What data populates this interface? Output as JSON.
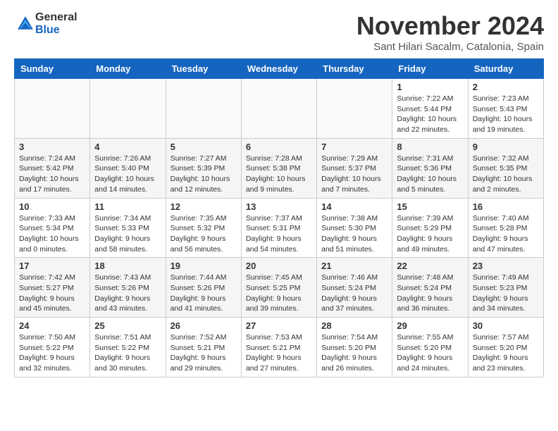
{
  "header": {
    "logo_general": "General",
    "logo_blue": "Blue",
    "month_title": "November 2024",
    "location": "Sant Hilari Sacalm, Catalonia, Spain"
  },
  "days_of_week": [
    "Sunday",
    "Monday",
    "Tuesday",
    "Wednesday",
    "Thursday",
    "Friday",
    "Saturday"
  ],
  "weeks": [
    [
      {
        "day": "",
        "info": ""
      },
      {
        "day": "",
        "info": ""
      },
      {
        "day": "",
        "info": ""
      },
      {
        "day": "",
        "info": ""
      },
      {
        "day": "",
        "info": ""
      },
      {
        "day": "1",
        "info": "Sunrise: 7:22 AM\nSunset: 5:44 PM\nDaylight: 10 hours and 22 minutes."
      },
      {
        "day": "2",
        "info": "Sunrise: 7:23 AM\nSunset: 5:43 PM\nDaylight: 10 hours and 19 minutes."
      }
    ],
    [
      {
        "day": "3",
        "info": "Sunrise: 7:24 AM\nSunset: 5:42 PM\nDaylight: 10 hours and 17 minutes."
      },
      {
        "day": "4",
        "info": "Sunrise: 7:26 AM\nSunset: 5:40 PM\nDaylight: 10 hours and 14 minutes."
      },
      {
        "day": "5",
        "info": "Sunrise: 7:27 AM\nSunset: 5:39 PM\nDaylight: 10 hours and 12 minutes."
      },
      {
        "day": "6",
        "info": "Sunrise: 7:28 AM\nSunset: 5:38 PM\nDaylight: 10 hours and 9 minutes."
      },
      {
        "day": "7",
        "info": "Sunrise: 7:29 AM\nSunset: 5:37 PM\nDaylight: 10 hours and 7 minutes."
      },
      {
        "day": "8",
        "info": "Sunrise: 7:31 AM\nSunset: 5:36 PM\nDaylight: 10 hours and 5 minutes."
      },
      {
        "day": "9",
        "info": "Sunrise: 7:32 AM\nSunset: 5:35 PM\nDaylight: 10 hours and 2 minutes."
      }
    ],
    [
      {
        "day": "10",
        "info": "Sunrise: 7:33 AM\nSunset: 5:34 PM\nDaylight: 10 hours and 0 minutes."
      },
      {
        "day": "11",
        "info": "Sunrise: 7:34 AM\nSunset: 5:33 PM\nDaylight: 9 hours and 58 minutes."
      },
      {
        "day": "12",
        "info": "Sunrise: 7:35 AM\nSunset: 5:32 PM\nDaylight: 9 hours and 56 minutes."
      },
      {
        "day": "13",
        "info": "Sunrise: 7:37 AM\nSunset: 5:31 PM\nDaylight: 9 hours and 54 minutes."
      },
      {
        "day": "14",
        "info": "Sunrise: 7:38 AM\nSunset: 5:30 PM\nDaylight: 9 hours and 51 minutes."
      },
      {
        "day": "15",
        "info": "Sunrise: 7:39 AM\nSunset: 5:29 PM\nDaylight: 9 hours and 49 minutes."
      },
      {
        "day": "16",
        "info": "Sunrise: 7:40 AM\nSunset: 5:28 PM\nDaylight: 9 hours and 47 minutes."
      }
    ],
    [
      {
        "day": "17",
        "info": "Sunrise: 7:42 AM\nSunset: 5:27 PM\nDaylight: 9 hours and 45 minutes."
      },
      {
        "day": "18",
        "info": "Sunrise: 7:43 AM\nSunset: 5:26 PM\nDaylight: 9 hours and 43 minutes."
      },
      {
        "day": "19",
        "info": "Sunrise: 7:44 AM\nSunset: 5:26 PM\nDaylight: 9 hours and 41 minutes."
      },
      {
        "day": "20",
        "info": "Sunrise: 7:45 AM\nSunset: 5:25 PM\nDaylight: 9 hours and 39 minutes."
      },
      {
        "day": "21",
        "info": "Sunrise: 7:46 AM\nSunset: 5:24 PM\nDaylight: 9 hours and 37 minutes."
      },
      {
        "day": "22",
        "info": "Sunrise: 7:48 AM\nSunset: 5:24 PM\nDaylight: 9 hours and 36 minutes."
      },
      {
        "day": "23",
        "info": "Sunrise: 7:49 AM\nSunset: 5:23 PM\nDaylight: 9 hours and 34 minutes."
      }
    ],
    [
      {
        "day": "24",
        "info": "Sunrise: 7:50 AM\nSunset: 5:22 PM\nDaylight: 9 hours and 32 minutes."
      },
      {
        "day": "25",
        "info": "Sunrise: 7:51 AM\nSunset: 5:22 PM\nDaylight: 9 hours and 30 minutes."
      },
      {
        "day": "26",
        "info": "Sunrise: 7:52 AM\nSunset: 5:21 PM\nDaylight: 9 hours and 29 minutes."
      },
      {
        "day": "27",
        "info": "Sunrise: 7:53 AM\nSunset: 5:21 PM\nDaylight: 9 hours and 27 minutes."
      },
      {
        "day": "28",
        "info": "Sunrise: 7:54 AM\nSunset: 5:20 PM\nDaylight: 9 hours and 26 minutes."
      },
      {
        "day": "29",
        "info": "Sunrise: 7:55 AM\nSunset: 5:20 PM\nDaylight: 9 hours and 24 minutes."
      },
      {
        "day": "30",
        "info": "Sunrise: 7:57 AM\nSunset: 5:20 PM\nDaylight: 9 hours and 23 minutes."
      }
    ]
  ]
}
